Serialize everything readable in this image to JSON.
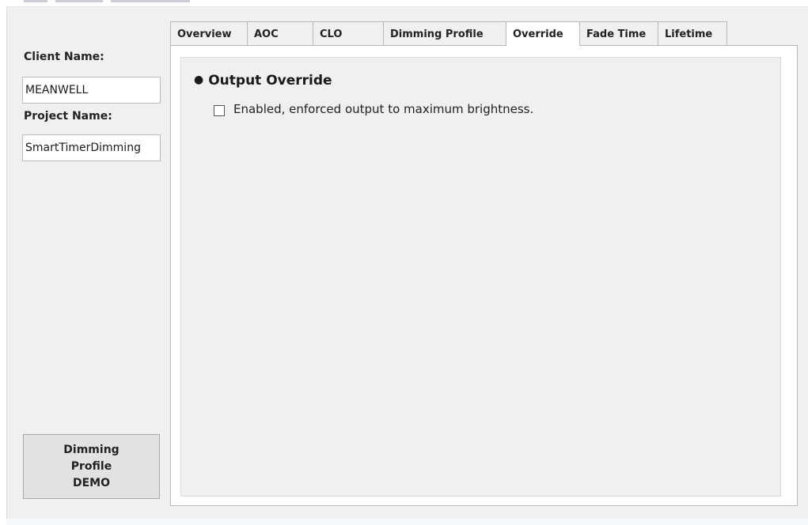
{
  "sidebar": {
    "client_name_label": "Client Name:",
    "client_name_value": "MEANWELL",
    "project_name_label": "Project Name:",
    "project_name_value": "SmartTimerDimming",
    "demo_button_label": "Dimming\nProfile\nDEMO"
  },
  "tabs": [
    {
      "label": "Overview",
      "active": false
    },
    {
      "label": "AOC",
      "active": false
    },
    {
      "label": "CLO",
      "active": false
    },
    {
      "label": "Dimming Profile",
      "active": false
    },
    {
      "label": "Override",
      "active": true
    },
    {
      "label": "Fade Time",
      "active": false
    },
    {
      "label": "Lifetime",
      "active": false
    }
  ],
  "override_panel": {
    "section_title": "Output Override",
    "checkbox_label": "Enabled, enforced output to maximum brightness.",
    "checkbox_checked": false
  }
}
